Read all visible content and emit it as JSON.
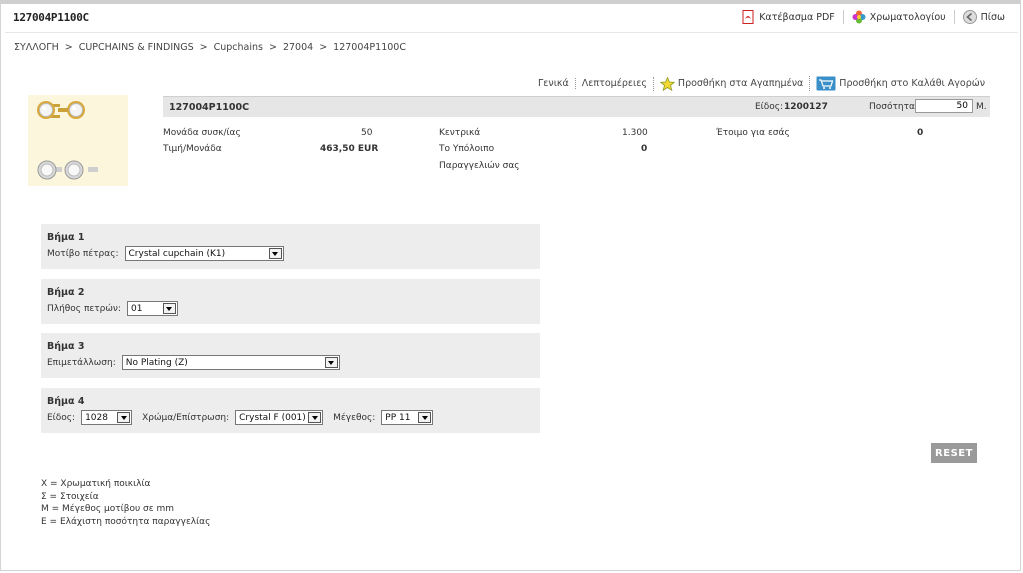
{
  "page": {
    "title": "127004P1100C"
  },
  "toolbar": {
    "pdf_label": "Κατέβασμα PDF",
    "colors_label": "Χρωματολογίου",
    "back_label": "Πίσω"
  },
  "breadcrumb": {
    "items": [
      "ΣΥΛΛΟΓΗ",
      "CUPCHAINS & FINDINGS",
      "Cupchains",
      "27004",
      "127004P1100C"
    ],
    "separator": ">"
  },
  "tabs": {
    "general": "Γενικά",
    "details": "Λεπτομέρειες",
    "favorites": "Προσθήκη στα Αγαπημένα",
    "cart": "Προσθήκη στο Καλάθι Αγορών"
  },
  "product": {
    "code": "127004P1100C",
    "eidos_label": "Είδος:",
    "eidos_value": "1200127",
    "quantity_label": "Ποσότητα:",
    "quantity_value": "50",
    "quantity_unit": "Μ.",
    "pack_unit_label": "Μονάδα συσκ/ίας",
    "pack_unit_value": "50",
    "unit_price_label": "Τιμή/Μονάδα",
    "unit_price_value": "463,50 EUR",
    "central_label": "Κεντρικά",
    "central_value": "1.300",
    "remaining_label_1": "Το Υπόλοιπο",
    "remaining_label_2": "Παραγγελιών σας",
    "remaining_value": "0",
    "ready_label": "Έτοιμο για εσάς",
    "ready_value": "0"
  },
  "steps": [
    {
      "title": "Βήμα 1",
      "label": "Μοτίβο πέτρας:",
      "value": "Crystal cupchain (K1)"
    },
    {
      "title": "Βήμα 2",
      "label": "Πλήθος πετρών:",
      "value": "01"
    },
    {
      "title": "Βήμα 3",
      "label": "Επιμετάλλωση:",
      "value": "No Plating (Z)"
    },
    {
      "title": "Βήμα 4",
      "label": "Είδος:",
      "value": "1028",
      "label2": "Χρώμα/Επίστρωση:",
      "value2": "Crystal F (001)",
      "label3": "Μέγεθος:",
      "value3": "PP 11"
    }
  ],
  "reset_label": "RESET",
  "legend": [
    "X = Χρωματική ποικιλία",
    "Σ = Στοιχεία",
    "M = Μέγεθος μοτίβου σε mm",
    "E = Ελάχιστη ποσότητα παραγγελίας"
  ],
  "icons": {
    "pdf": "pdf-icon",
    "colors": "color-palette-icon",
    "back": "back-arrow-icon",
    "favorites": "star-icon",
    "cart": "cart-icon"
  },
  "colors": {
    "accent_red": "#cc2222",
    "reset_bg": "#9a9a9a",
    "step_bg": "#ededed"
  }
}
